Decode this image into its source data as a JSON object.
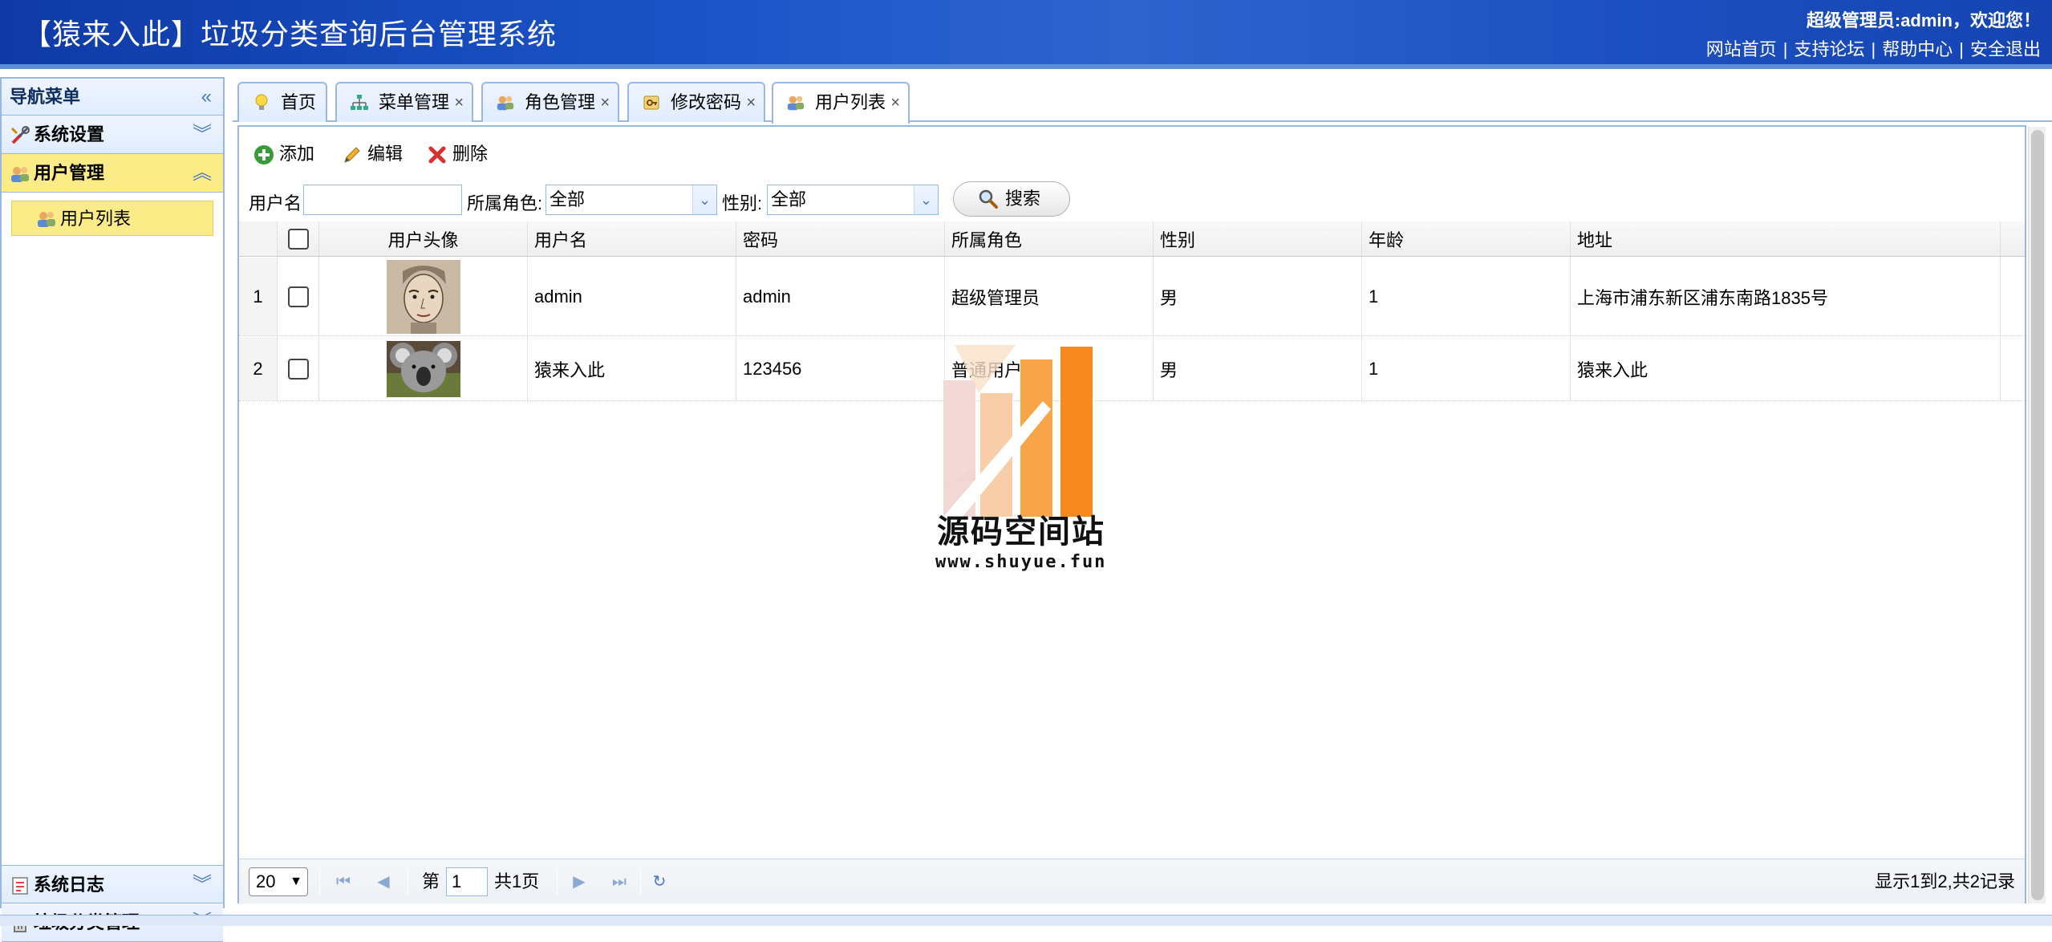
{
  "header": {
    "title": "【猿来入此】垃圾分类查询后台管理系统",
    "welcome": "超级管理员:admin，欢迎您！",
    "links": [
      "网站首页",
      "支持论坛",
      "帮助中心",
      "安全退出"
    ]
  },
  "sidebar": {
    "title": "导航菜单",
    "collapse_icon": "double-chevron-left-icon",
    "groups": [
      {
        "label": "系统设置",
        "icon": "tools-icon",
        "expanded": false
      },
      {
        "label": "用户管理",
        "icon": "users-icon",
        "expanded": true
      },
      {
        "label": "系统日志",
        "icon": "log-icon",
        "expanded": false
      },
      {
        "label": "垃圾分类管理",
        "icon": "trash-icon",
        "expanded": false
      }
    ],
    "items": [
      {
        "label": "用户列表",
        "icon": "users-icon",
        "selected": true
      }
    ]
  },
  "tabs": [
    {
      "label": "首页",
      "icon": "bulb-icon",
      "closable": false
    },
    {
      "label": "菜单管理",
      "icon": "sitemap-icon",
      "closable": true
    },
    {
      "label": "角色管理",
      "icon": "users-icon",
      "closable": true
    },
    {
      "label": "修改密码",
      "icon": "key-icon",
      "closable": true
    },
    {
      "label": "用户列表",
      "icon": "users-icon",
      "closable": true,
      "active": true
    }
  ],
  "tab_close": "×",
  "toolbar": {
    "add": "添加",
    "edit": "编辑",
    "delete": "删除"
  },
  "search": {
    "username_label": "用户名:",
    "username_value": "",
    "role_label": "所属角色:",
    "role_value": "全部",
    "gender_label": "性别:",
    "gender_value": "全部",
    "button": "搜索"
  },
  "table": {
    "columns": [
      "用户头像",
      "用户名",
      "密码",
      "所属角色",
      "性别",
      "年龄",
      "地址"
    ],
    "rows": [
      {
        "num": "1",
        "username": "admin",
        "password": "admin",
        "role": "超级管理员",
        "gender": "男",
        "age": "1",
        "address": "上海市浦东新区浦东南路1835号"
      },
      {
        "num": "2",
        "username": "猿来入此",
        "password": "123456",
        "role": "普通用户",
        "gender": "男",
        "age": "1",
        "address": "猿来入此"
      }
    ]
  },
  "watermark": {
    "name": "源码空间站",
    "url": "www.shuyue.fun"
  },
  "pager": {
    "page_size": "20",
    "page_prefix": "第",
    "page_value": "1",
    "page_total": "共1页",
    "info": "显示1到2,共2记录"
  },
  "colors": {
    "header_blue": "#1b55c8",
    "border_blue": "#95b8e7",
    "highlight_yellow": "#fbec88",
    "watermark_orange": "#f7891e"
  }
}
